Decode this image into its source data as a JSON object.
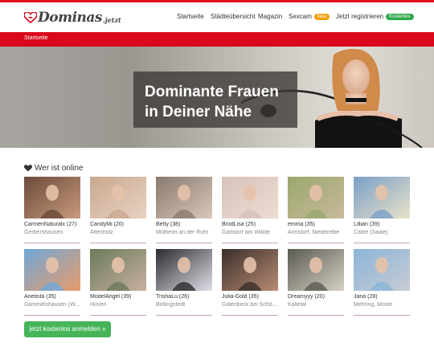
{
  "logo": {
    "main": "Dominas",
    "tld": ".jetzt"
  },
  "nav": {
    "startseite": "Startseite",
    "staedte": "Städteübersicht",
    "magazin": "Magazin",
    "sexcam": "Sexcam",
    "sexcam_badge": "Neu",
    "register": "Jetzt registrieren",
    "register_badge": "Kostenlos"
  },
  "breadcrumb": "Startseite",
  "hero": {
    "title": "Dominante Frauen in Deiner Nähe"
  },
  "section": {
    "title": "Wer ist online"
  },
  "profiles": [
    {
      "name": "CarmenNaturalx (27)",
      "city": "Gerbershausen"
    },
    {
      "name": "CandyMi (20)",
      "city": "Altenholz"
    },
    {
      "name": "Betty (38)",
      "city": "Mülheim an der Ruhr"
    },
    {
      "name": "BrodLisa (25)",
      "city": "Garlstorf am Walde"
    },
    {
      "name": "emma (35)",
      "city": "Armstorf, Niederelbe"
    },
    {
      "name": "Lillian (39)",
      "city": "Calbe (Saale)"
    },
    {
      "name": "Anetista (35)",
      "city": "Gammelshausen (W..."
    },
    {
      "name": "ModelAngel (39)",
      "city": "Hüven"
    },
    {
      "name": "TrishaLu (26)",
      "city": "Bollingstedt"
    },
    {
      "name": "Julia-Gold (35)",
      "city": "Galenbeck bei Schö..."
    },
    {
      "name": "Dreamyyy (20)",
      "city": "Kalletal"
    },
    {
      "name": "Jana (28)",
      "city": "Mehring, Mosel"
    }
  ],
  "cta": {
    "label": "jetzt kostenlos anmelden »"
  },
  "colors": {
    "brand_red": "#d9081a",
    "green": "#46b55a",
    "badge_orange": "#f0a10e"
  },
  "icons": {
    "logo": "heart-lips-logo-icon",
    "section": "heart-icon"
  }
}
